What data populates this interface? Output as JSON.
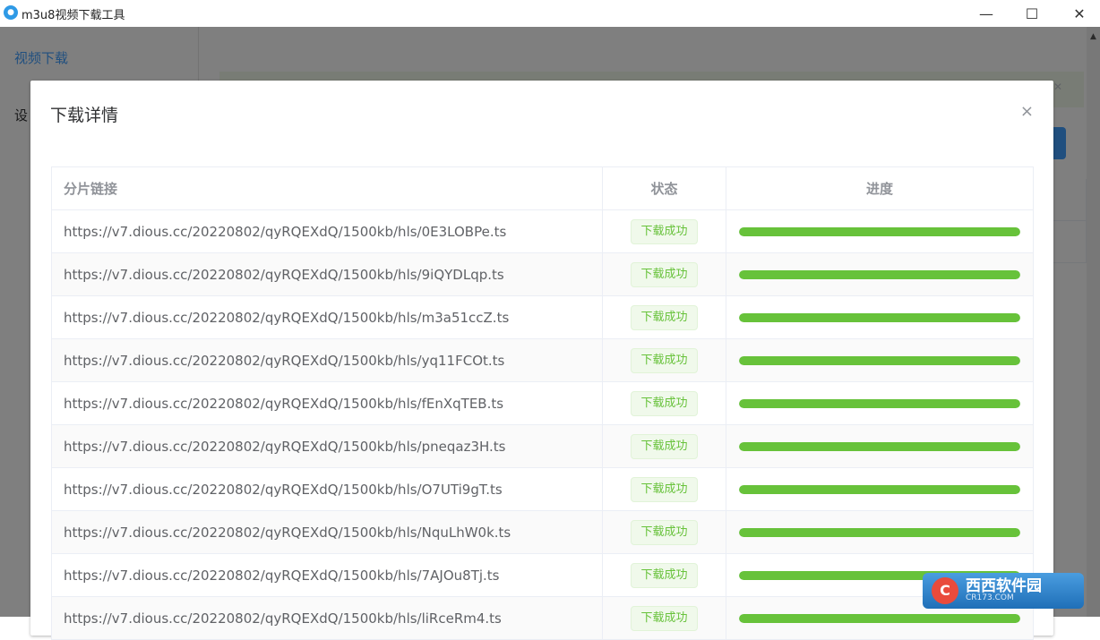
{
  "window": {
    "title": "m3u8视频下载工具",
    "icon": "app-logo-icon",
    "controls": {
      "minimize": "—",
      "maximize": "☐",
      "close": "✕"
    }
  },
  "sidebar": {
    "items": [
      {
        "label": "视频下载",
        "active": true
      },
      {
        "label": "设"
      }
    ]
  },
  "dialog": {
    "title": "下载详情",
    "close_glyph": "×",
    "table": {
      "columns": [
        "分片链接",
        "状态",
        "进度"
      ],
      "rows": [
        {
          "link": "https://v7.dious.cc/20220802/qyRQEXdQ/1500kb/hls/0E3LOBPe.ts",
          "status": "下载成功",
          "progress": 100
        },
        {
          "link": "https://v7.dious.cc/20220802/qyRQEXdQ/1500kb/hls/9iQYDLqp.ts",
          "status": "下载成功",
          "progress": 100
        },
        {
          "link": "https://v7.dious.cc/20220802/qyRQEXdQ/1500kb/hls/m3a51ccZ.ts",
          "status": "下载成功",
          "progress": 100
        },
        {
          "link": "https://v7.dious.cc/20220802/qyRQEXdQ/1500kb/hls/yq11FCOt.ts",
          "status": "下载成功",
          "progress": 100
        },
        {
          "link": "https://v7.dious.cc/20220802/qyRQEXdQ/1500kb/hls/fEnXqTEB.ts",
          "status": "下载成功",
          "progress": 100
        },
        {
          "link": "https://v7.dious.cc/20220802/qyRQEXdQ/1500kb/hls/pneqaz3H.ts",
          "status": "下载成功",
          "progress": 100
        },
        {
          "link": "https://v7.dious.cc/20220802/qyRQEXdQ/1500kb/hls/O7UTi9gT.ts",
          "status": "下载成功",
          "progress": 100
        },
        {
          "link": "https://v7.dious.cc/20220802/qyRQEXdQ/1500kb/hls/NquLhW0k.ts",
          "status": "下载成功",
          "progress": 100
        },
        {
          "link": "https://v7.dious.cc/20220802/qyRQEXdQ/1500kb/hls/7AJOu8Tj.ts",
          "status": "下载成功",
          "progress": 100
        },
        {
          "link": "https://v7.dious.cc/20220802/qyRQEXdQ/1500kb/hls/liRceRm4.ts",
          "status": "下载成功",
          "progress": 100
        }
      ]
    }
  },
  "watermark": {
    "main": "西西软件园",
    "sub": "CR173.COM",
    "logo": "C"
  },
  "colors": {
    "accent": "#409eff",
    "success": "#67c23a",
    "success_bg": "#f0f9eb"
  }
}
